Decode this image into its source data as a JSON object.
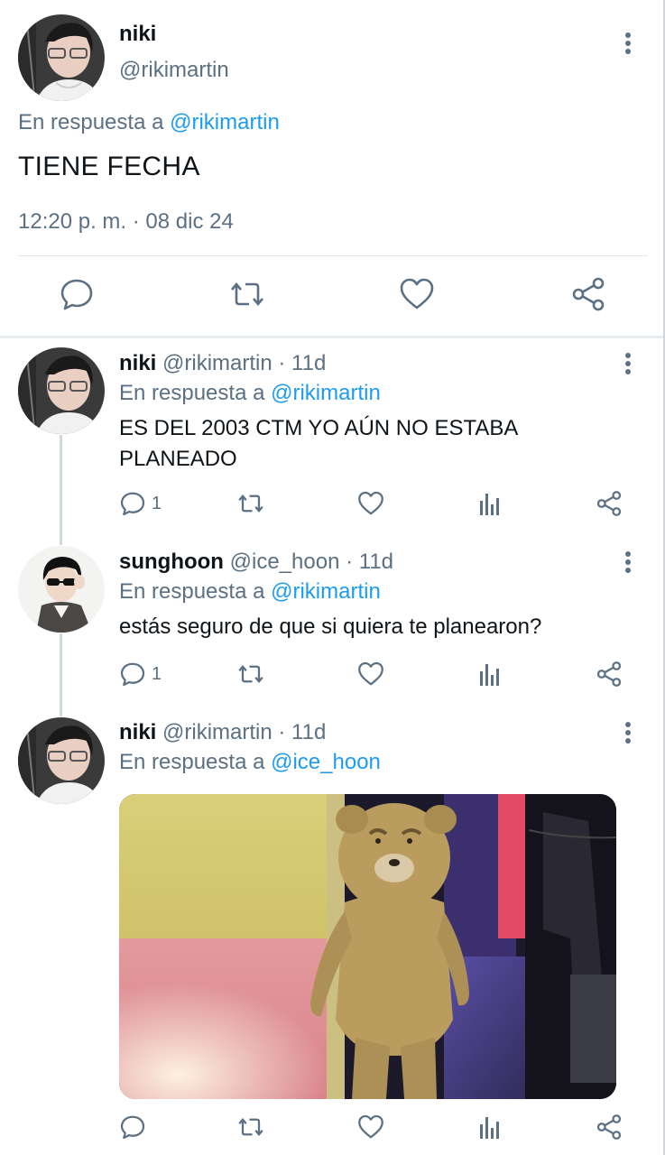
{
  "main_tweet": {
    "author_name": "niki",
    "author_handle": "@rikimartin",
    "reply_prefix": "En respuesta a ",
    "reply_to": "@rikimartin",
    "text": "TIENE FECHA",
    "timestamp": "12:20 p. m. · 08 dic 24",
    "actions": [
      "reply-icon",
      "retweet-icon",
      "like-icon",
      "share-icon"
    ]
  },
  "replies": [
    {
      "author_name": "niki",
      "author_meta": "@rikimartin · 11d",
      "reply_prefix": "En respuesta a ",
      "reply_to": "@rikimartin",
      "text": "ES DEL 2003 CTM YO AÚN NO ESTABA PLANEADO",
      "reply_count": "1"
    },
    {
      "author_name": "sunghoon",
      "author_meta": "@ice_hoon · 11d",
      "reply_prefix": "En respuesta a ",
      "reply_to": "@rikimartin",
      "text": "estás seguro de que si quiera te planearon?",
      "reply_count": "1"
    },
    {
      "author_name": "niki",
      "author_meta": "@rikimartin · 11d",
      "reply_prefix": "En respuesta a ",
      "reply_to": "@ice_hoon",
      "text": "",
      "reply_count": ""
    }
  ],
  "colors": {
    "accent": "#1d9bf0",
    "secondary_text": "#5b7083",
    "icon": "#5b7083",
    "divider": "#e1e8ed"
  }
}
